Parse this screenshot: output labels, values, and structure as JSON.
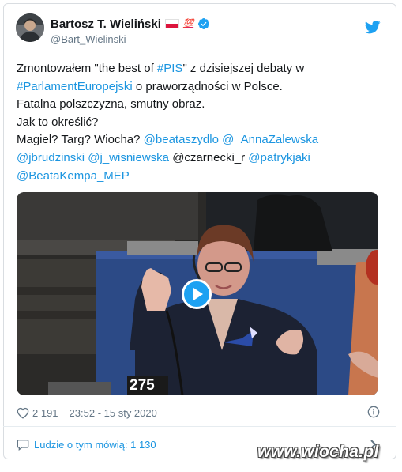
{
  "author": {
    "name": "Bartosz T. Wieliński",
    "handle": "@Bart_Wielinski",
    "emoji_badge": "💯"
  },
  "tweet": {
    "lines": [
      [
        {
          "t": "Zmontowałem \"the best of "
        },
        {
          "t": "#PIS",
          "link": true
        },
        {
          "t": "\" z dzisiejszej debaty w"
        }
      ],
      [
        {
          "t": "#ParlamentEuropejski",
          "link": true
        },
        {
          "t": " o praworządności w Polsce."
        }
      ],
      [
        {
          "t": "Fatalna polszczyzna, smutny obraz."
        }
      ],
      [
        {
          "t": "Jak to określić?"
        }
      ],
      [
        {
          "t": "Magiel? Targ? Wiocha? "
        },
        {
          "t": "@beataszydlo",
          "link": true
        },
        {
          "t": " "
        },
        {
          "t": "@_AnnaZalewska",
          "link": true
        }
      ],
      [
        {
          "t": "@jbrudzinski",
          "link": true
        },
        {
          "t": " "
        },
        {
          "t": "@j_wisniewska",
          "link": true
        },
        {
          "t": " @czarnecki_r "
        },
        {
          "t": "@patrykjaki",
          "link": true
        }
      ],
      [
        {
          "t": "@BeataKempa_MEP",
          "link": true
        }
      ]
    ]
  },
  "media": {
    "seat_number": "275"
  },
  "meta": {
    "likes": "2 191",
    "timestamp": "23:52 - 15 sty 2020"
  },
  "people": {
    "label": "Ludzie o tym mówią: 1 130"
  },
  "watermark": "www.wiocha.pl",
  "colors": {
    "link": "#1b95e0",
    "verified": "#1da1f2",
    "text": "#14171a",
    "muted": "#657786"
  },
  "icons": [
    "twitter-bird-icon",
    "verified-icon",
    "heart-icon",
    "info-icon",
    "people-icon",
    "chevron-right-icon",
    "play-icon"
  ]
}
